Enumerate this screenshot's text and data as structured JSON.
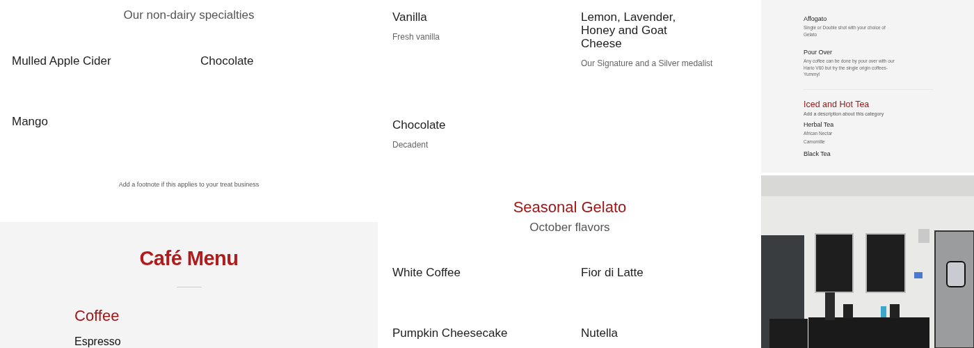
{
  "sorbetto_section": {
    "subtitle": "Our non-dairy specialties",
    "items": [
      {
        "name": "Mulled Apple Cider"
      },
      {
        "name": "Chocolate"
      },
      {
        "name": "Mango"
      }
    ],
    "footnote": "Add a footnote if this applies to your treat business"
  },
  "cafe_menu": {
    "logo": "Café Menu",
    "category": "Coffee",
    "items": [
      {
        "name": "Espresso"
      }
    ]
  },
  "gelato_items": [
    {
      "name": "Vanilla",
      "description": "Fresh vanilla"
    },
    {
      "name": "Lemon, Lavender, Honey and Goat Cheese",
      "description": "Our Signature and a Silver medalist"
    },
    {
      "name": "Chocolate",
      "description": "Decadent"
    }
  ],
  "seasonal_gelato": {
    "title": "Seasonal Gelato",
    "subtitle": "October flavors",
    "items": [
      {
        "name": "White Coffee"
      },
      {
        "name": "Fior di Latte"
      },
      {
        "name": "Pumpkin Cheesecake"
      },
      {
        "name": "Nutella"
      }
    ]
  },
  "menu_preview": {
    "items": [
      {
        "name": "Affogato",
        "description": "Single or Double shot with your choice of Gelato"
      },
      {
        "name": "Pour Over",
        "description": "Any coffee can be done by pour over with our Hario V60 but try the single origin coffees- Yummy!"
      }
    ],
    "category": {
      "title": "Iced and Hot Tea",
      "description": "Add a description about this category",
      "items": [
        {
          "name": "Herbal Tea",
          "lines": [
            "African Nectar",
            "Camomille"
          ]
        },
        {
          "name": "Black Tea"
        }
      ]
    }
  }
}
